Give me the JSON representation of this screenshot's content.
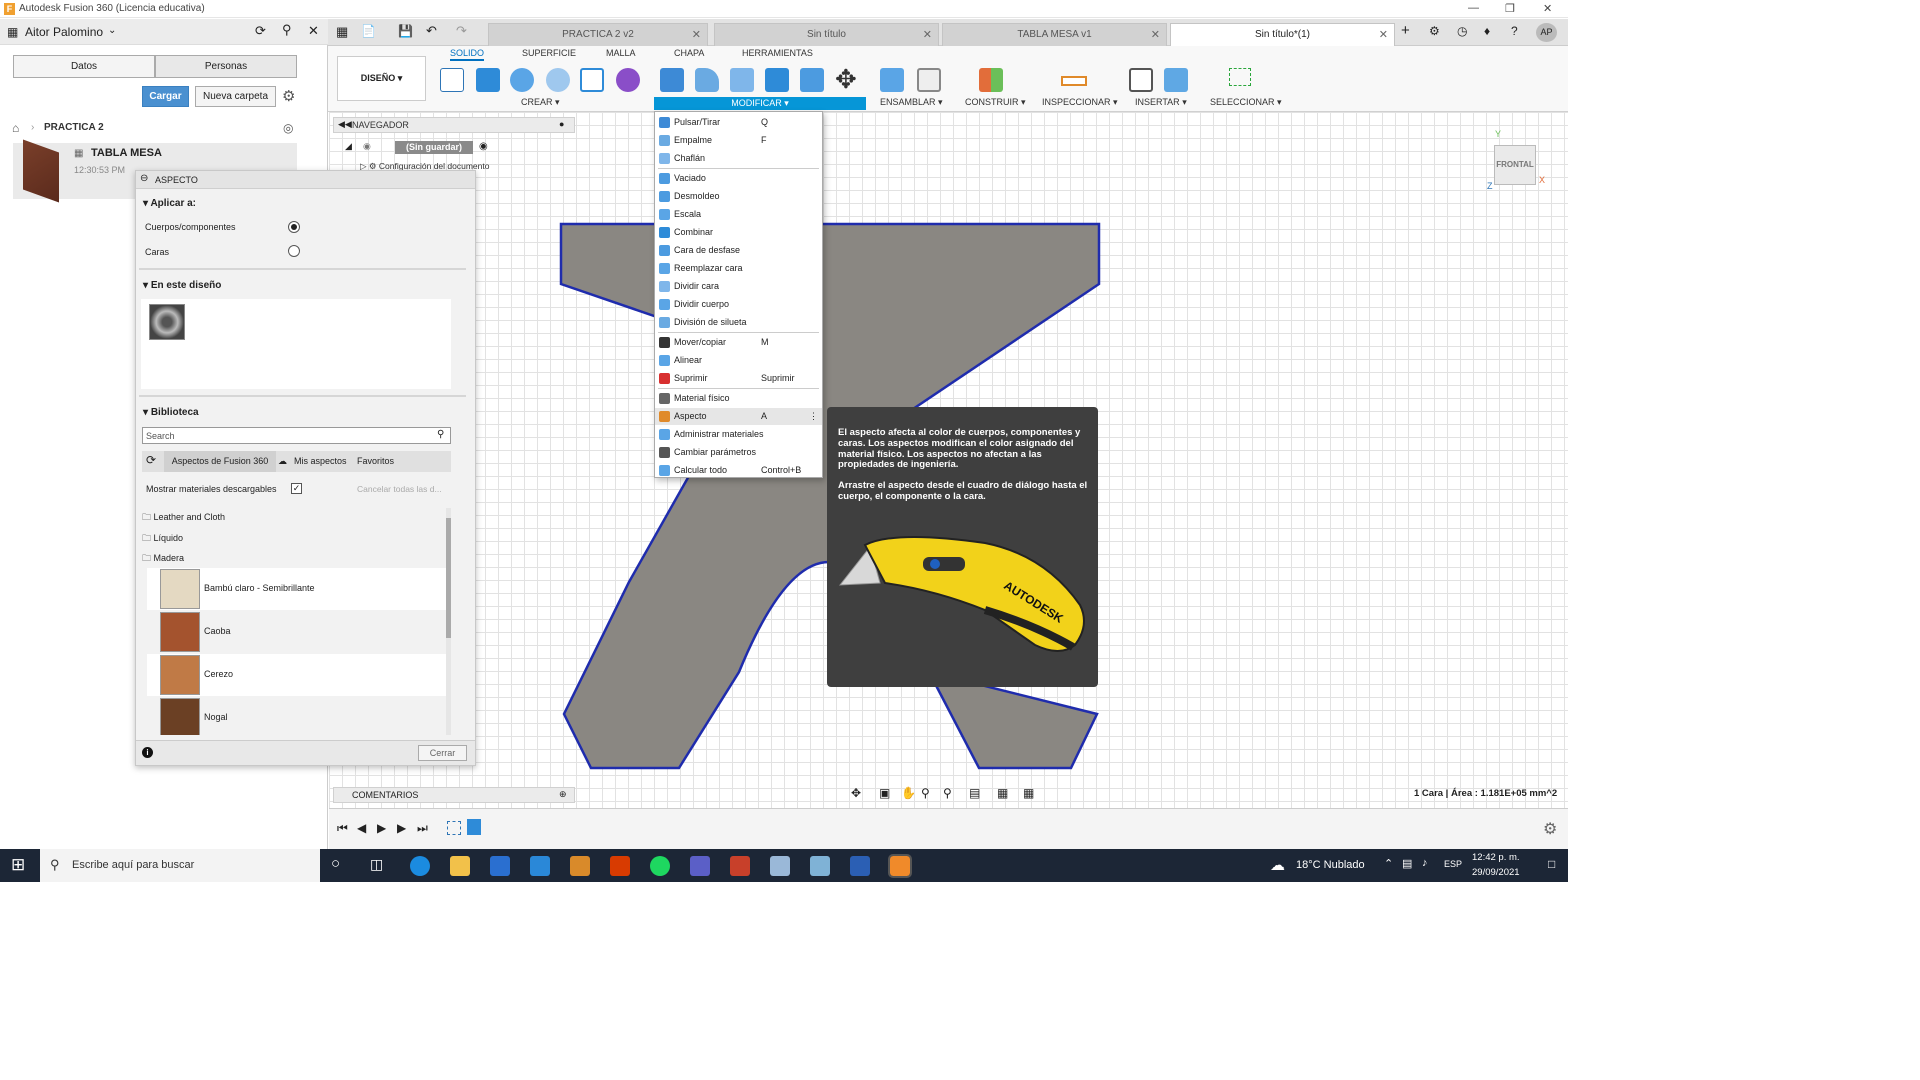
{
  "window": {
    "title": "Autodesk Fusion 360 (Licencia educativa)"
  },
  "data_panel": {
    "user": "Aitor Palomino",
    "tabs": [
      "Datos",
      "Personas"
    ],
    "upload_button": "Cargar",
    "new_folder_button": "Nueva carpeta",
    "breadcrumb": "PRACTICA 2",
    "file": {
      "name": "TABLA MESA",
      "time": "12:30:53 PM"
    }
  },
  "doc_tabs": [
    {
      "label": "PRACTICA 2 v2"
    },
    {
      "label": "Sin título"
    },
    {
      "label": "TABLA MESA v1"
    },
    {
      "label": "Sin título*(1)"
    }
  ],
  "user_initials": "AP",
  "toolbar": {
    "workspace": "DISEÑO",
    "tabs": [
      "SOLIDO",
      "SUPERFICIE",
      "MALLA",
      "CHAPA",
      "HERRAMIENTAS"
    ],
    "groups": [
      "CREAR",
      "MODIFICAR",
      "ENSAMBLAR",
      "CONSTRUIR",
      "INSPECCIONAR",
      "INSERTAR",
      "SELECCIONAR"
    ]
  },
  "navigator": {
    "title": "NAVEGADOR",
    "root": "(Sin guardar)",
    "child": "Configuración del documento"
  },
  "aspecto": {
    "title": "ASPECTO",
    "apply_label": "Aplicar a:",
    "options": [
      "Cuerpos/componentes",
      "Caras"
    ],
    "design_label": "En este diseño",
    "library_label": "Biblioteca",
    "search_placeholder": "Search",
    "lib_tabs": [
      "Aspectos de Fusion 360",
      "Mis aspectos",
      "Favoritos"
    ],
    "show_downloadable": "Mostrar materiales descargables",
    "cancel_all": "Cancelar todas las d...",
    "folders": [
      "Leather and Cloth",
      "Líquido",
      "Madera"
    ],
    "materials": [
      {
        "name": "Bambú claro - Semibrillante",
        "color": "#e4d9c2"
      },
      {
        "name": "Caoba",
        "color": "#a4532e"
      },
      {
        "name": "Cerezo",
        "color": "#c07a46"
      },
      {
        "name": "Nogal",
        "color": "#6b4024"
      }
    ],
    "close_button": "Cerrar"
  },
  "menu": {
    "header": "MODIFICAR",
    "items": [
      {
        "label": "Pulsar/Tirar",
        "shortcut": "Q"
      },
      {
        "label": "Empalme",
        "shortcut": "F"
      },
      {
        "label": "Chaflán",
        "shortcut": ""
      },
      {
        "label": "Vaciado",
        "shortcut": ""
      },
      {
        "label": "Desmoldeo",
        "shortcut": ""
      },
      {
        "label": "Escala",
        "shortcut": ""
      },
      {
        "label": "Combinar",
        "shortcut": ""
      },
      {
        "label": "Cara de desfase",
        "shortcut": ""
      },
      {
        "label": "Reemplazar cara",
        "shortcut": ""
      },
      {
        "label": "Dividir cara",
        "shortcut": ""
      },
      {
        "label": "Dividir cuerpo",
        "shortcut": ""
      },
      {
        "label": "División de silueta",
        "shortcut": ""
      },
      {
        "label": "Mover/copiar",
        "shortcut": "M"
      },
      {
        "label": "Alinear",
        "shortcut": ""
      },
      {
        "label": "Suprimir",
        "shortcut": "Suprimir"
      },
      {
        "label": "Material físico",
        "shortcut": ""
      },
      {
        "label": "Aspecto",
        "shortcut": "A"
      },
      {
        "label": "Administrar materiales",
        "shortcut": ""
      },
      {
        "label": "Cambiar parámetros",
        "shortcut": ""
      },
      {
        "label": "Calcular todo",
        "shortcut": "Control+B"
      }
    ]
  },
  "tooltip": {
    "p1": "El aspecto afecta al color de cuerpos, componentes y caras. Los aspectos modifican el color asignado del material físico. Los aspectos no afectan a las propiedades de ingeniería.",
    "p2": "Arrastre el aspecto desde el cuadro de diálogo hasta el cuerpo, el componente o la cara.",
    "brand": "AUTODESK"
  },
  "viewcube": {
    "face": "FRONTAL"
  },
  "status": {
    "selection": "1 Cara | Área : 1.181E+05 mm^2"
  },
  "comments": "COMENTARIOS",
  "taskbar": {
    "search": "Escribe aquí para buscar",
    "weather": "18°C Nublado",
    "lang": "ESP",
    "time": "12:42 p. m.",
    "date": "29/09/2021"
  },
  "colors": {
    "accent": "#0696d7",
    "shape_fill": "#8a8782",
    "shape_edge": "#1f2cad"
  }
}
